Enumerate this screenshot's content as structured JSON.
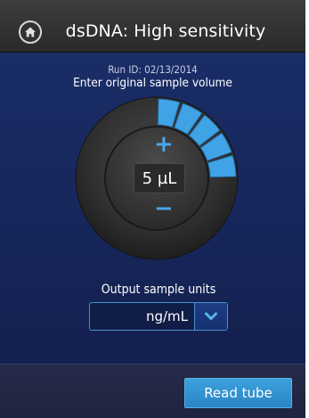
{
  "header": {
    "title": "dsDNA: High sensitivity",
    "home_icon": "home-icon"
  },
  "run_id": "Run ID: 02/13/2014",
  "prompt": "Enter original sample volume",
  "dial": {
    "plus_symbol": "+",
    "minus_symbol": "−",
    "volume": "5 µL",
    "arc_color": "#3fa3e6",
    "segments_filled": 5
  },
  "output_units": {
    "label": "Output sample units",
    "selected": "ng/mL",
    "arrow_icon": "chevron-down-icon"
  },
  "footer": {
    "read_button_label": "Read tube"
  }
}
